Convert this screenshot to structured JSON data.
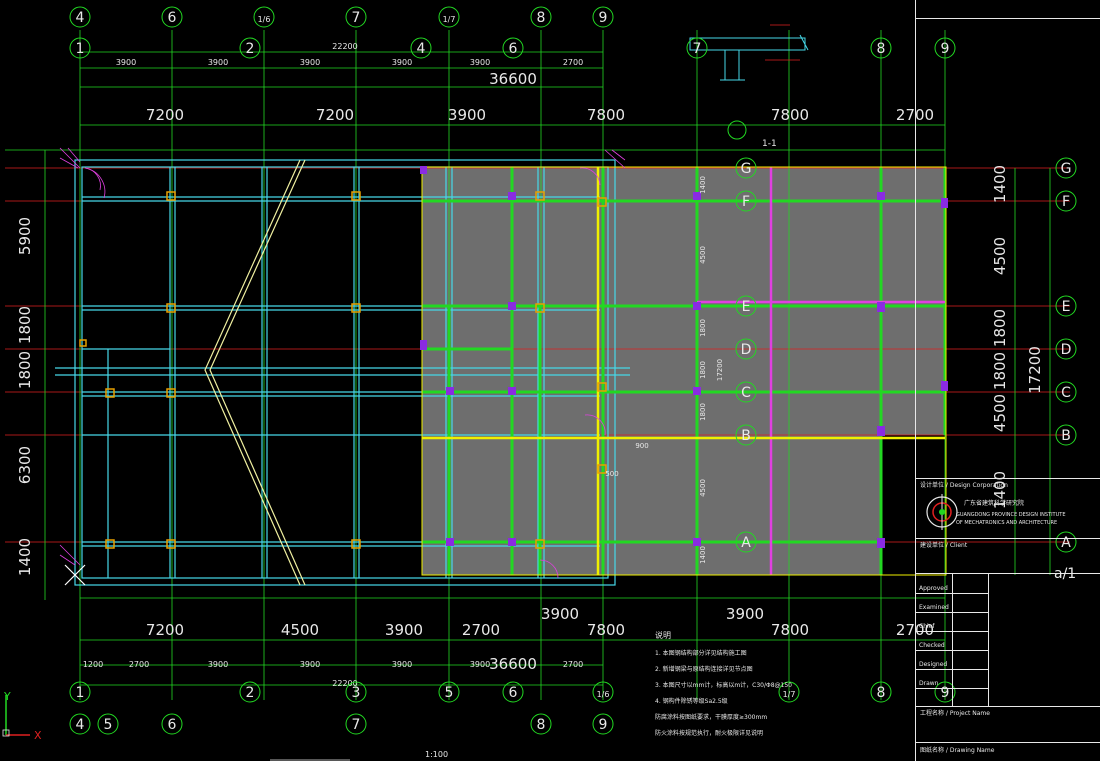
{
  "drawing": {
    "scale": "1:100",
    "section_label": "1-1",
    "sheet_number": "a/1"
  },
  "grid_top_row1": [
    "4",
    "6",
    "1/6",
    "7",
    "1/7",
    "8",
    "9"
  ],
  "grid_top_row2": [
    "1",
    "2",
    "4",
    "6",
    "7",
    "8",
    "9"
  ],
  "dims_top_small": [
    "3900",
    "3900",
    "3900",
    "3900",
    "3900",
    "2700"
  ],
  "dim_top_22200": "22200",
  "dim_top_36600": "36600",
  "dims_top_large": [
    "7200",
    "7200",
    "3900",
    "7800",
    "7800",
    "2700"
  ],
  "dims_left": [
    "5900",
    "1800",
    "1800",
    "6300",
    "1400"
  ],
  "dims_right": [
    "1400",
    "4500",
    "1800",
    "1800",
    "4500",
    "1400"
  ],
  "dim_right_total": "17200",
  "grid_right_letters": [
    "G",
    "F",
    "E",
    "D",
    "C",
    "B",
    "A"
  ],
  "dims_bottom_large": [
    "7200",
    "4500",
    "3900",
    "2700",
    "3900",
    "7800",
    "3900",
    "7800",
    "2700"
  ],
  "dims_bottom_small": [
    "1200",
    "2700",
    "3900",
    "3900",
    "3900",
    "3900",
    "2700"
  ],
  "dim_bottom_22200": "22200",
  "dim_bottom_36600": "36600",
  "grid_bottom_row1": [
    "1",
    "2",
    "3",
    "5",
    "6",
    "1/6",
    "1/7",
    "8",
    "9"
  ],
  "grid_bottom_row2": [
    "4",
    "5",
    "6",
    "7",
    "8",
    "9"
  ],
  "inner_dims": [
    "1400",
    "4500",
    "1800",
    "1800",
    "1800",
    "4500",
    "1400",
    "17200",
    "900",
    "500"
  ],
  "title_block": {
    "design_corp": "设计单位 / Design Corporation",
    "institute_cn": "广东省建筑科学研究院",
    "institute_en1": "GUANGDONG PROVINCE DESIGN INSTITUTE",
    "institute_en2": "OF MECHATRONICS AND ARCHITECTURE",
    "client": "建设单位 / Client",
    "roles": [
      "Approved",
      "Examined",
      "Chief",
      "Checked",
      "Designed",
      "Drawn"
    ],
    "project_name": "工程名称 / Project Name",
    "drawing_name": "图纸名称 / Drawing Name"
  },
  "notes_title": "说明",
  "notes": [
    "1. 本图钢结构部分详见结构施工图",
    "2. 新增钢梁与原结构连接详见节点图",
    "3. 本图尺寸以mm计，标高以m计，C30/Φ8@150",
    "4. 钢构件除锈等级Sa2.5级",
    "   防腐涂料按图纸要求，干膜厚度≥300mm",
    "   防火涂料按规范执行，耐火极限详见说明"
  ],
  "ucs": {
    "x": "X",
    "y": "Y"
  },
  "colors": {
    "green": "#22d822",
    "cyan": "#46d8e8",
    "yellow": "#f0f000",
    "magenta": "#e040e0",
    "red": "#e02020",
    "orange": "#e8a000",
    "purple": "#8a2be2",
    "gray": "#6e6e6e",
    "white": "#e8e8e8"
  }
}
